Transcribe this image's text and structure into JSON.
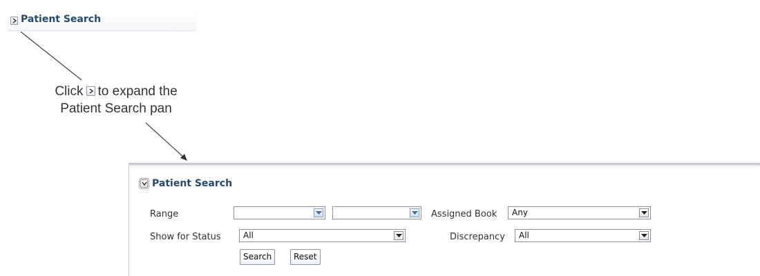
{
  "collapsed_panel": {
    "title": "Patient Search",
    "toggle_icon": "chevron-right-icon"
  },
  "callout": {
    "text_before": "Click",
    "text_after": "to expand the",
    "line2": "Patient Search pan"
  },
  "expanded_panel": {
    "title": "Patient Search",
    "toggle_icon": "chevron-down-icon",
    "fields": {
      "range_label": "Range",
      "range_from_value": "",
      "range_to_value": "",
      "assigned_book_label": "Assigned Book",
      "assigned_book_value": "Any",
      "show_for_status_label": "Show for Status",
      "show_for_status_value": "All",
      "discrepancy_label": "Discrepancy",
      "discrepancy_value": "All"
    },
    "buttons": {
      "search": "Search",
      "reset": "Reset"
    }
  },
  "colors": {
    "title": "#22496f",
    "dropdown_arrow_accent": "#3d6fa3"
  }
}
